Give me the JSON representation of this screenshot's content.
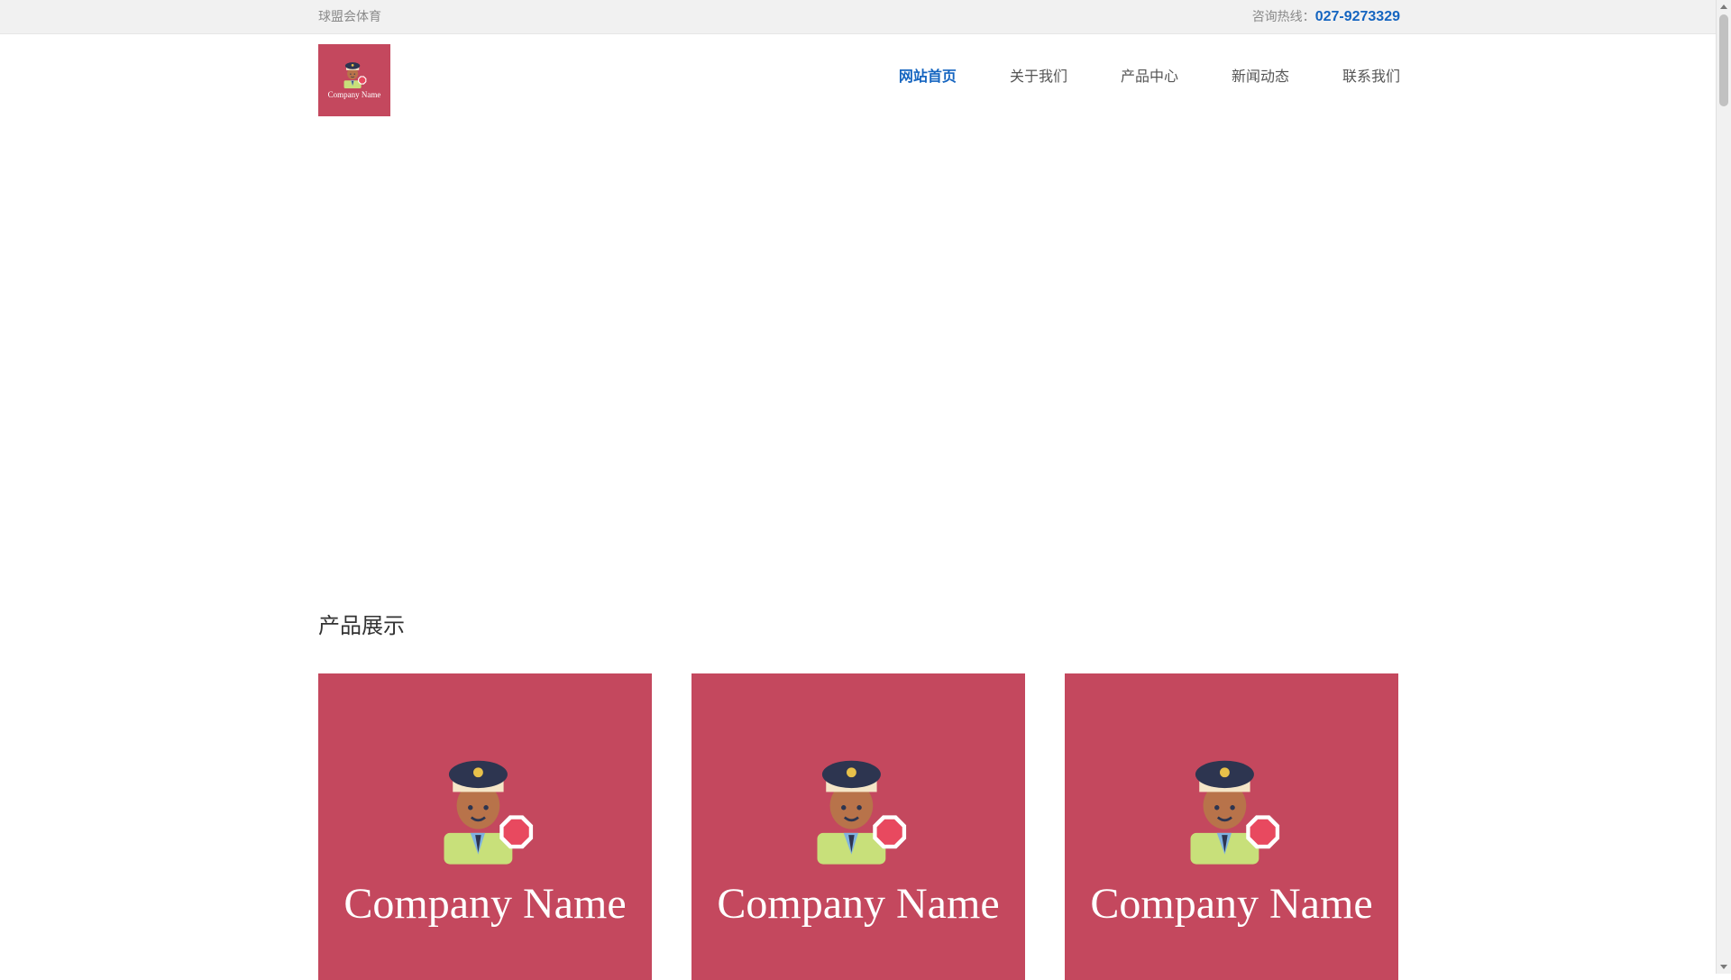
{
  "topbar": {
    "site_name": "球盟会体育",
    "hotline_label": "咨询热线：",
    "hotline_number": "027-9273329"
  },
  "logo": {
    "text": "Company Name",
    "icon": "police-officer-stop-sign-icon"
  },
  "nav": {
    "items": [
      {
        "label": "网站首页",
        "active": true
      },
      {
        "label": "关于我们",
        "active": false
      },
      {
        "label": "产品中心",
        "active": false
      },
      {
        "label": "新闻动态",
        "active": false
      },
      {
        "label": "联系我们",
        "active": false
      }
    ]
  },
  "products": {
    "title": "产品展示",
    "cards": [
      {
        "text": "Company Name",
        "icon": "police-officer-stop-sign-icon"
      },
      {
        "text": "Company Name",
        "icon": "police-officer-stop-sign-icon"
      },
      {
        "text": "Company Name",
        "icon": "police-officer-stop-sign-icon"
      }
    ]
  },
  "colors": {
    "accent": "#1565c0",
    "brand": "#c4485e",
    "topbar_bg": "#f1f1f1"
  }
}
